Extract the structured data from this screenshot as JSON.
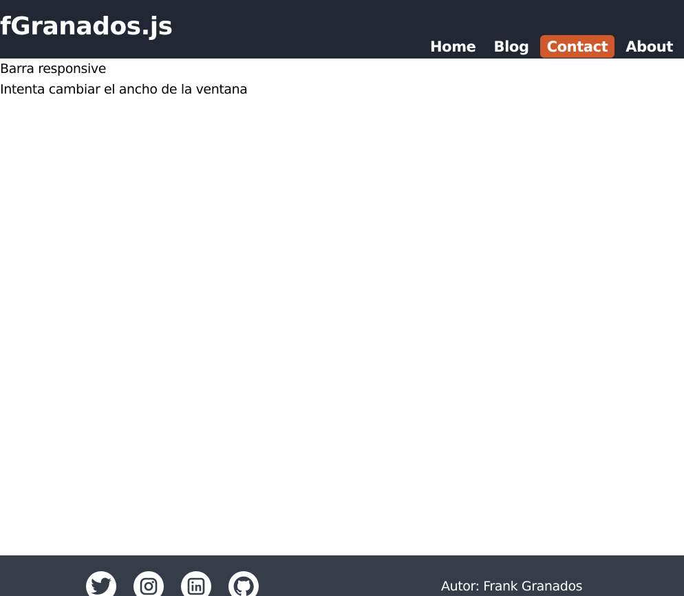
{
  "header": {
    "brand": "fGranados.js",
    "background_color": "#232733",
    "nav": [
      {
        "label": "Home",
        "active": false
      },
      {
        "label": "Blog",
        "active": false
      },
      {
        "label": "Contact",
        "active": true
      },
      {
        "label": "About",
        "active": false
      }
    ],
    "active_color": "#d0592c"
  },
  "main": {
    "title_text": "Barra responsive",
    "subtitle_text": "Intenta cambiar el ancho de la ventana"
  },
  "footer": {
    "background_color": "#373c49",
    "social": [
      {
        "icon": "twitter-icon"
      },
      {
        "icon": "instagram-icon"
      },
      {
        "icon": "linkedin-icon"
      },
      {
        "icon": "github-icon"
      }
    ],
    "author": "Autor: Frank Granados"
  }
}
